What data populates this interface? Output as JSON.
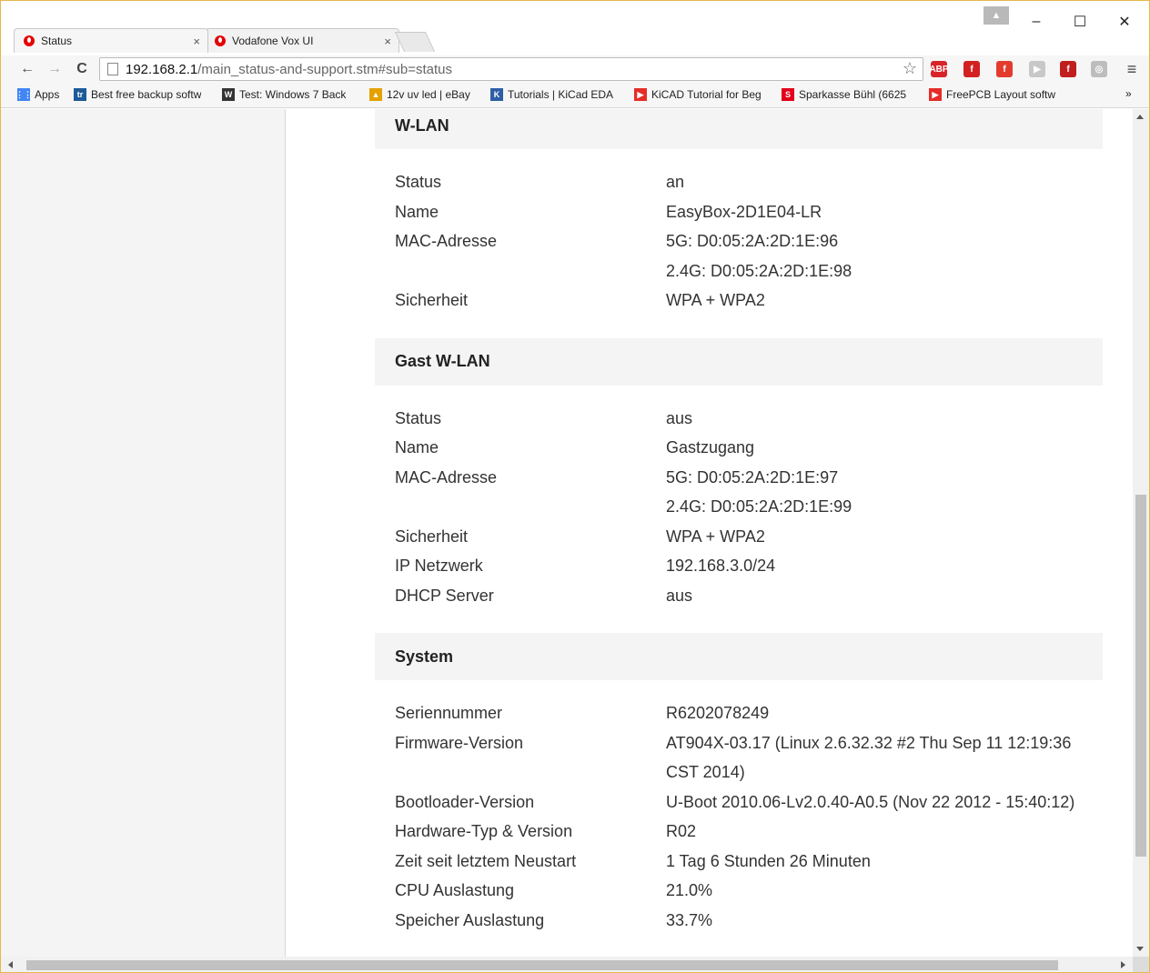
{
  "tabs": [
    {
      "label": "Status",
      "close": "×"
    },
    {
      "label": "Vodafone Vox UI",
      "close": "×"
    }
  ],
  "window_controls": {
    "minimize": "–",
    "maximize": "☐",
    "close": "✕",
    "profile": "▲"
  },
  "toolbar": {
    "back": "←",
    "forward": "→",
    "reload": "C",
    "url_host": "192.168.2.1",
    "url_path": "/main_status-and-support.stm#sub=status",
    "star": "☆",
    "menu": "≡"
  },
  "extensions": [
    {
      "name": "adblock-plus-icon",
      "label": "ABP",
      "color": "#d8232a"
    },
    {
      "name": "flash-icon",
      "label": "f",
      "color": "#d32020"
    },
    {
      "name": "flash-alt-icon",
      "label": "f",
      "color": "#e33b2e"
    },
    {
      "name": "play-icon",
      "label": "▶",
      "color": "#c8c8c8"
    },
    {
      "name": "flash-player-icon",
      "label": "f",
      "color": "#c11e1e"
    },
    {
      "name": "eye-icon",
      "label": "◎",
      "color": "#bdbdbd"
    }
  ],
  "bookmarks": [
    {
      "label": "Apps",
      "icon": "apps-grid-icon",
      "color": "#4285f4",
      "glyph": "⋮⋮"
    },
    {
      "label": "Best free backup softw",
      "icon": "tr-icon",
      "color": "#1c5a99",
      "glyph": "tr"
    },
    {
      "label": "Test: Windows 7 Back",
      "icon": "winpro-icon",
      "color": "#333333",
      "glyph": "W"
    },
    {
      "label": "12v uv led | eBay",
      "icon": "ebay-icon",
      "color": "#e5a100",
      "glyph": "▲"
    },
    {
      "label": "Tutorials | KiCad EDA",
      "icon": "kicad-icon",
      "color": "#2e5ea6",
      "glyph": "K"
    },
    {
      "label": "KiCAD Tutorial for Beg",
      "icon": "youtube-icon",
      "color": "#e52d27",
      "glyph": "▶"
    },
    {
      "label": "Sparkasse Bühl (6625",
      "icon": "sparkasse-icon",
      "color": "#e2001a",
      "glyph": "S"
    },
    {
      "label": "FreePCB Layout softw",
      "icon": "youtube-icon-2",
      "color": "#e52d27",
      "glyph": "▶"
    }
  ],
  "bookmarks_more": "»",
  "sections": [
    {
      "title": "W-LAN",
      "rows": [
        {
          "k": "Status",
          "v": "an"
        },
        {
          "k": "Name",
          "v": "EasyBox-2D1E04-LR"
        },
        {
          "k": "MAC-Adresse",
          "v": "5G: D0:05:2A:2D:1E:96"
        },
        {
          "k": "",
          "v": "2.4G: D0:05:2A:2D:1E:98"
        },
        {
          "k": "Sicherheit",
          "v": "WPA + WPA2"
        }
      ]
    },
    {
      "title": "Gast W-LAN",
      "rows": [
        {
          "k": "Status",
          "v": "aus"
        },
        {
          "k": "Name",
          "v": "Gastzugang"
        },
        {
          "k": "MAC-Adresse",
          "v": "5G: D0:05:2A:2D:1E:97"
        },
        {
          "k": "",
          "v": "2.4G: D0:05:2A:2D:1E:99"
        },
        {
          "k": "Sicherheit",
          "v": "WPA + WPA2"
        },
        {
          "k": "IP Netzwerk",
          "v": "192.168.3.0/24"
        },
        {
          "k": "DHCP Server",
          "v": "aus"
        }
      ]
    },
    {
      "title": "System",
      "rows": [
        {
          "k": "Seriennummer",
          "v": "R6202078249"
        },
        {
          "k": "Firmware-Version",
          "v": "AT904X-03.17 (Linux 2.6.32.32 #2 Thu Sep 11 12:19:36 CST 2014)"
        },
        {
          "k": "Bootloader-Version",
          "v": "U-Boot 2010.06-Lv2.0.40-A0.5 (Nov 22 2012 - 15:40:12)"
        },
        {
          "k": "Hardware-Typ & Version",
          "v": "R02"
        },
        {
          "k": "Zeit seit letztem Neustart",
          "v": "1 Tag 6 Stunden 26 Minuten"
        },
        {
          "k": "CPU Auslastung",
          "v": "21.0%"
        },
        {
          "k": "Speicher Auslastung",
          "v": "33.7%"
        }
      ]
    }
  ]
}
